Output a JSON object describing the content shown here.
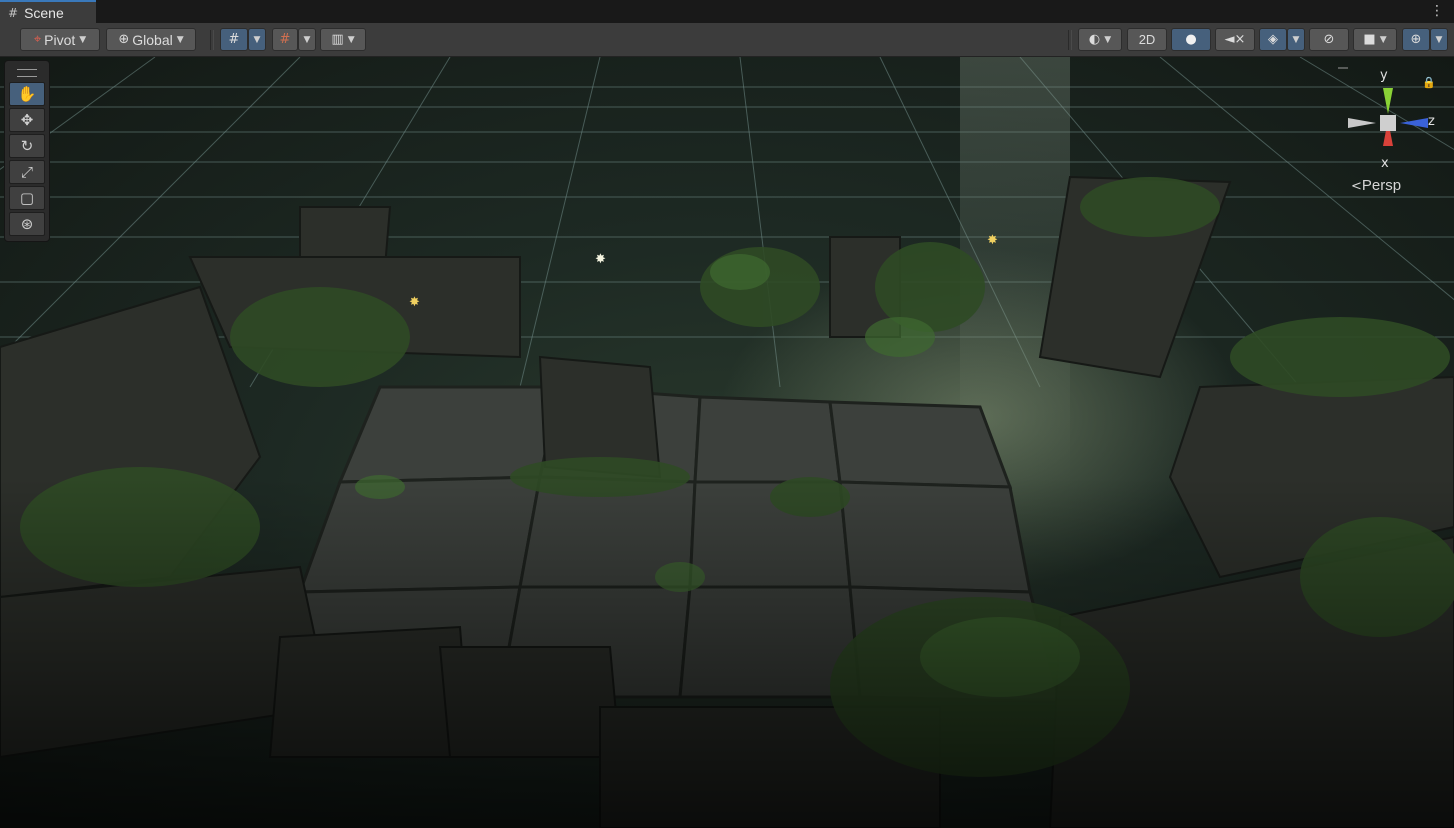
{
  "window": {
    "tab_title": "Scene",
    "tab_glyph": "#",
    "menu_glyph": "⋮"
  },
  "toolbar": {
    "pivot_label": "Pivot",
    "global_label": "Global",
    "two_d_label": "2D",
    "icons": [
      "pivot-icon",
      "global-icon",
      "grid-snapping-icon",
      "increment-snap-icon",
      "grid-visibility-icon",
      "shading-mode-icon",
      "lighting-icon",
      "audio-icon",
      "effects-icon",
      "visibility-icon",
      "camera-icon",
      "gizmos-icon"
    ]
  },
  "tools": [
    "hand-tool",
    "move-tool",
    "rotate-tool",
    "scale-tool",
    "rect-tool",
    "transform-tool"
  ],
  "gizmo": {
    "y": "y",
    "x": "x",
    "z": "z",
    "projection": "Persp"
  },
  "colors": {
    "accent": "#46607c",
    "tab_accent": "#3a79bb",
    "axis_x": "#d9423a",
    "axis_y": "#8ad236",
    "axis_z": "#3a62d9"
  }
}
